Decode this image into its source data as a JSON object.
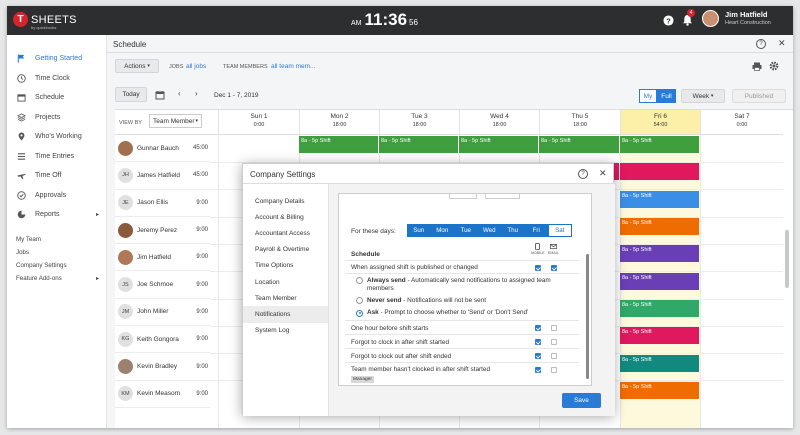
{
  "topbar": {
    "logo_letter": "T",
    "logo_text": "SHEETS",
    "logo_sub": "by quickbooks",
    "clock_ampm": "AM",
    "clock_hm": "11:36",
    "clock_sec": "56",
    "notif_count": "4",
    "user_name": "Jim Hatfield",
    "user_company": "Heart Construction"
  },
  "sidebar": {
    "items": [
      {
        "label": "Getting Started",
        "icon": "flag-icon"
      },
      {
        "label": "Time Clock",
        "icon": "clock-icon"
      },
      {
        "label": "Schedule",
        "icon": "calendar-icon"
      },
      {
        "label": "Projects",
        "icon": "projects-icon"
      },
      {
        "label": "Who's Working",
        "icon": "map-pin-icon"
      },
      {
        "label": "Time Entries",
        "icon": "list-icon"
      },
      {
        "label": "Time Off",
        "icon": "plane-icon"
      },
      {
        "label": "Approvals",
        "icon": "check-circle-icon"
      },
      {
        "label": "Reports",
        "icon": "pie-chart-icon"
      }
    ],
    "secondary": [
      "My Team",
      "Jobs",
      "Company Settings",
      "Feature Add-ons"
    ]
  },
  "schedule": {
    "title": "Schedule",
    "actions_label": "Actions",
    "jobs_label": "JOBS",
    "jobs_value": "all jobs",
    "team_label": "TEAM MEMBERS",
    "team_value": "all team mem...",
    "today_label": "Today",
    "date_range": "Dec 1 - 7, 2019",
    "view_my": "My",
    "view_full": "Full",
    "view_week": "Week",
    "published": "Published",
    "view_by_label": "VIEW BY",
    "view_by_value": "Team Member",
    "days": [
      {
        "name": "Sun 1",
        "hours": "0:00"
      },
      {
        "name": "Mon 2",
        "hours": "18:00"
      },
      {
        "name": "Tue 3",
        "hours": "18:00"
      },
      {
        "name": "Wed 4",
        "hours": "18:00"
      },
      {
        "name": "Thu 5",
        "hours": "18:00"
      },
      {
        "name": "Fri 6",
        "hours": "54:00"
      },
      {
        "name": "Sat 7",
        "hours": "0:00"
      }
    ],
    "employees": [
      {
        "name": "Gunnar Bauch",
        "hours": "45:00",
        "initials": "",
        "photo": true
      },
      {
        "name": "James Hatfield",
        "hours": "45:00",
        "initials": "JH",
        "photo": false
      },
      {
        "name": "Jason Ellis",
        "hours": "9:00",
        "initials": "JE",
        "photo": false
      },
      {
        "name": "Jeremy Perez",
        "hours": "9:00",
        "initials": "",
        "photo": true
      },
      {
        "name": "Jim Hatfield",
        "hours": "9:00",
        "initials": "",
        "photo": true
      },
      {
        "name": "Joe Schmoe",
        "hours": "9:00",
        "initials": "JS",
        "photo": false
      },
      {
        "name": "John Miller",
        "hours": "9:00",
        "initials": "JM",
        "photo": false
      },
      {
        "name": "Keith Gongora",
        "hours": "9:00",
        "initials": "KG",
        "photo": false
      },
      {
        "name": "Kevin Bradley",
        "hours": "9:00",
        "initials": "",
        "photo": true
      },
      {
        "name": "Kevin Measom",
        "hours": "9:00",
        "initials": "KM",
        "photo": false
      }
    ],
    "shift_label": "8a - 5p Shift",
    "colors": {
      "green": "#3f9f3f",
      "pink": "#e0195f",
      "blue": "#3a8ee6",
      "orange": "#ef6c00",
      "purple": "#6a3fb5",
      "teal": "#12897e"
    }
  },
  "modal": {
    "title": "Company Settings",
    "menu": [
      "Company Details",
      "Account & Billing",
      "Accountant Access",
      "Payroll & Overtime",
      "Time Options",
      "Location",
      "Team Member",
      "Notifications",
      "System Log"
    ],
    "for_these_days": "For these days:",
    "days": [
      "Sun",
      "Mon",
      "Tue",
      "Wed",
      "Thu",
      "Fri",
      "Sat"
    ],
    "schedule_header": "Schedule",
    "col_mobile": "MOBILE",
    "col_email": "EMAIL",
    "rows": [
      "When assigned shift is published or changed",
      "One hour before shift starts",
      "Forgot to clock in after shift started",
      "Forgot to clock out after shift ended",
      "Team member hasn't clocked in after shift started"
    ],
    "always_bold": "Always send",
    "always_text": " - Automatically send notifications to assigned team members",
    "never_bold": "Never send",
    "never_text": " - Notifications will not be sent",
    "ask_bold": "Ask",
    "ask_text": " - Prompt to choose whether to 'Send' or 'Don't Send'",
    "manager_tag": "Manager",
    "save_label": "Save"
  }
}
